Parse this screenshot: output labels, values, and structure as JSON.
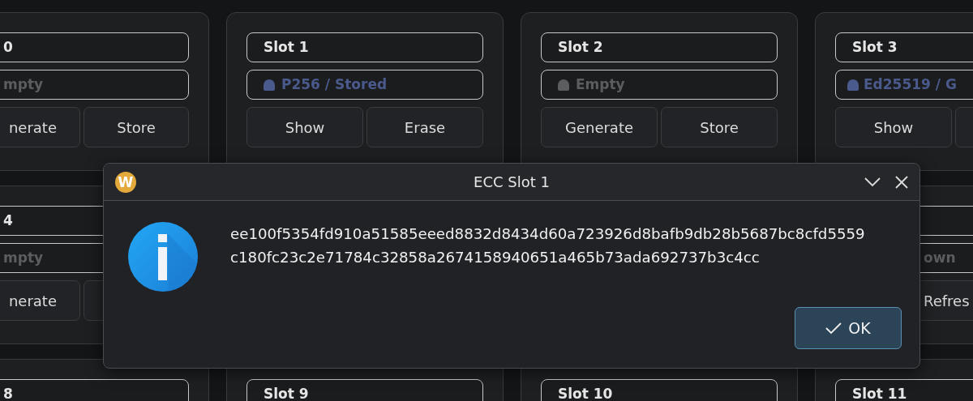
{
  "rows": [
    {
      "slots": [
        {
          "title": "0",
          "status": {
            "text": "mpty"
          },
          "buttons": [
            {
              "label": "nerate"
            },
            {
              "label": "Store"
            }
          ]
        },
        {
          "title": "Slot 1",
          "status": {
            "text": "P256 / Stored",
            "color": "#4b5a8c"
          },
          "buttons": [
            {
              "label": "Show"
            },
            {
              "label": "Erase"
            }
          ]
        },
        {
          "title": "Slot 2",
          "status": {
            "text": "Empty",
            "color": "#5c5d5f"
          },
          "buttons": [
            {
              "label": "Generate"
            },
            {
              "label": "Store"
            }
          ]
        },
        {
          "title": "Slot 3",
          "status": {
            "text": "Ed25519 / G",
            "color": "#4b5a8c"
          },
          "buttons": [
            {
              "label": "Show"
            }
          ]
        }
      ]
    },
    {
      "slots": [
        {
          "title": "4",
          "status": {
            "text": "mpty"
          },
          "buttons": [
            {
              "label": "nerate"
            }
          ]
        },
        {
          "status": {
            "text": "own"
          },
          "buttons": [
            {
              "label": "Refres"
            }
          ]
        }
      ]
    },
    {
      "slots": [
        {
          "title": "8"
        },
        {
          "title": "Slot 9"
        },
        {
          "title": "Slot 10"
        },
        {
          "title": "Slot 11"
        }
      ]
    }
  ],
  "dialog": {
    "title": "ECC Slot 1",
    "logo_letter": "W",
    "message_lines": [
      "ee100f5354fd910a51585eeed8832d8434d60a723926d8bafb9db28b5687bc8cfd5559",
      "c180fc23c2e71784c32858a2674158940651a465b73ada692737b3c4cc"
    ],
    "buttons": [
      {
        "label": "OK"
      }
    ]
  }
}
